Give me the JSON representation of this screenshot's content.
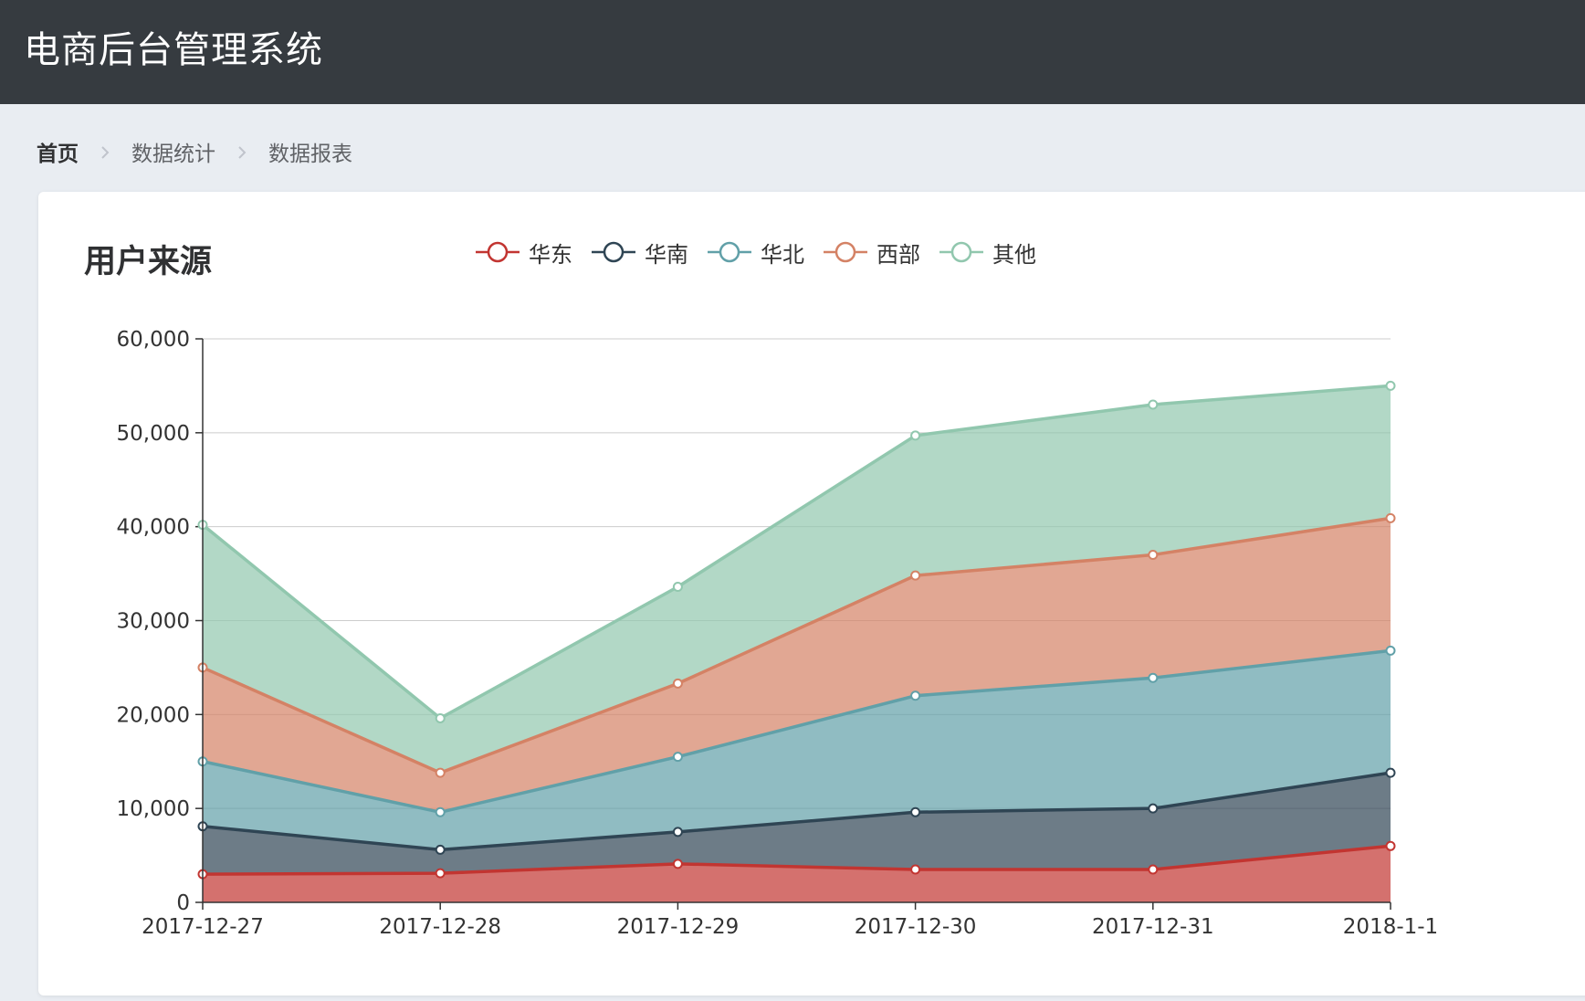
{
  "header": {
    "app_title": "电商后台管理系统"
  },
  "breadcrumb": {
    "items": [
      "首页",
      "数据统计",
      "数据报表"
    ]
  },
  "colors": {
    "header_bg": "#363b40",
    "page_bg": "#e9edf2",
    "series": [
      "#c23531",
      "#2f4554",
      "#61a0a8",
      "#d48265",
      "#91c7ae"
    ]
  },
  "chart_data": {
    "type": "area",
    "stacked": true,
    "title": "用户来源",
    "legend_position": "top",
    "grid": true,
    "x": [
      "2017-12-27",
      "2017-12-28",
      "2017-12-29",
      "2017-12-30",
      "2017-12-31",
      "2018-1-1"
    ],
    "y_ticks": [
      "0",
      "10,000",
      "20,000",
      "30,000",
      "40,000",
      "50,000",
      "60,000"
    ],
    "ylim": [
      0,
      60000
    ],
    "series": [
      {
        "name": "华东",
        "values": [
          3000,
          3100,
          4100,
          3500,
          3500,
          6000
        ]
      },
      {
        "name": "华南",
        "values": [
          5100,
          2500,
          3400,
          6100,
          6500,
          7800
        ]
      },
      {
        "name": "华北",
        "values": [
          6900,
          4000,
          8000,
          12400,
          13900,
          13000
        ]
      },
      {
        "name": "西部",
        "values": [
          10000,
          4200,
          7800,
          12800,
          13100,
          14100
        ]
      },
      {
        "name": "其他",
        "values": [
          15200,
          5800,
          10300,
          14900,
          16000,
          14100
        ]
      }
    ]
  }
}
